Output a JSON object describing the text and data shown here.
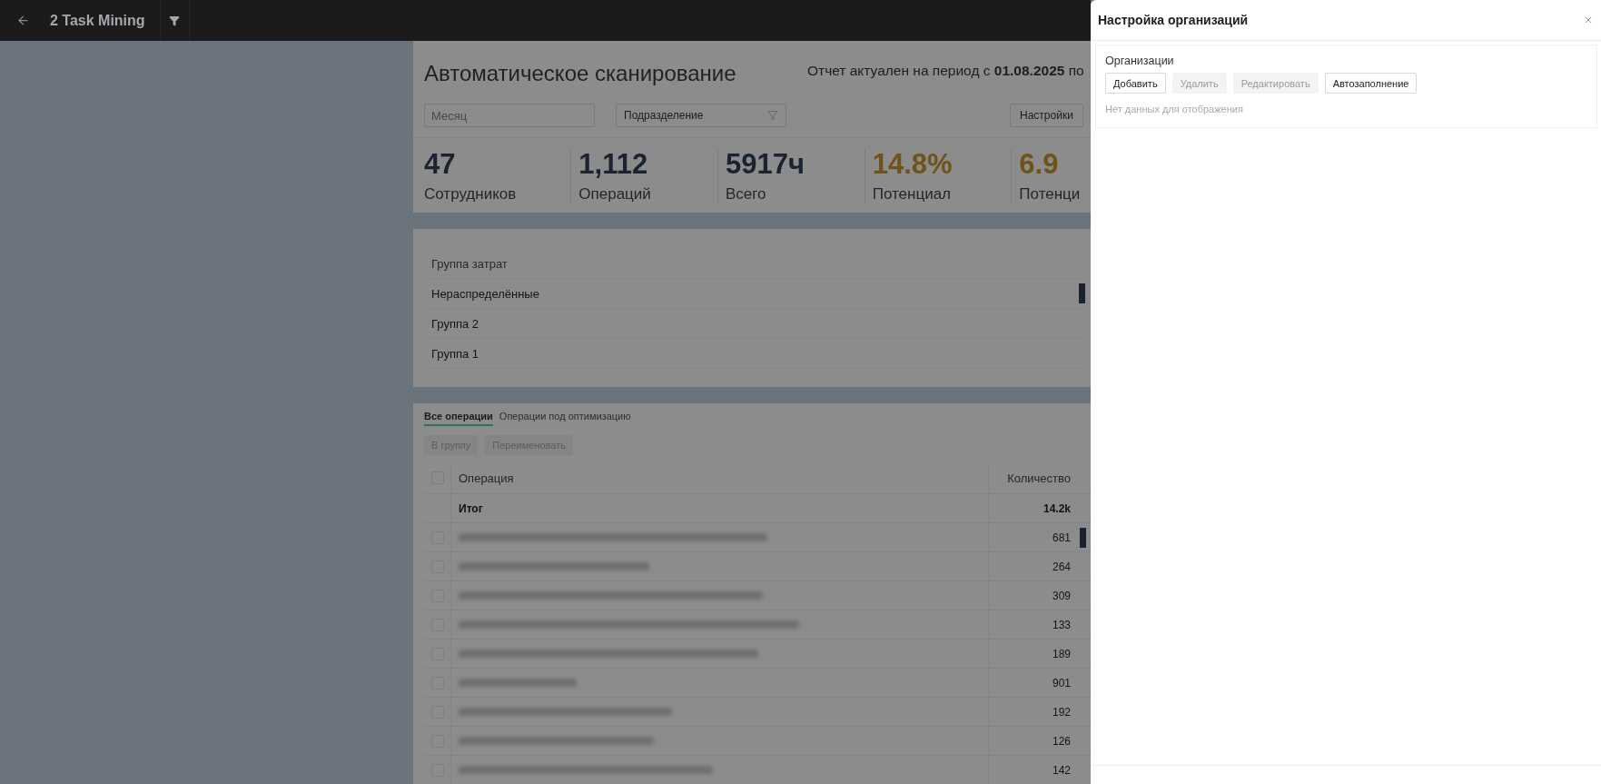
{
  "app_bar": {
    "title": "2 Task Mining"
  },
  "report": {
    "title": "Автоматическое сканирование",
    "period": "Отчет актуален на период с **01.08.2025** по"
  },
  "filters": {
    "month": {
      "placeholder": "Месяц"
    },
    "division": {
      "value": "Подразделение"
    },
    "settings_button": "Настройки"
  },
  "kpis": [
    {
      "value": "47",
      "label": "Сотрудников",
      "highlight": false
    },
    {
      "value": "1,112",
      "label": "Операций",
      "highlight": false
    },
    {
      "value": "5917ч",
      "label": "Всего",
      "highlight": false
    },
    {
      "value": "14.8%",
      "label": "Потенциал",
      "highlight": true
    },
    {
      "value": "6.9",
      "label": "Потенци",
      "highlight": true
    }
  ],
  "cost_groups": {
    "header": "Группа затрат",
    "rows": [
      {
        "name": "Нераспределённые",
        "bar": true
      },
      {
        "name": "Группа 2",
        "bar": false
      },
      {
        "name": "Группа 1",
        "bar": false
      }
    ]
  },
  "operations": {
    "tabs": [
      {
        "label": "Все операции",
        "selected": true
      },
      {
        "label": "Операции под оптимизацию",
        "selected": false
      }
    ],
    "buttons": [
      {
        "label": "В группу",
        "disabled": true
      },
      {
        "label": "Переименовать",
        "disabled": true
      }
    ],
    "columns": [
      "Операция",
      "Количество"
    ],
    "header_checked": false,
    "total": {
      "label": "Итог",
      "count": "14.2k"
    },
    "rows": [
      {
        "count": "681",
        "checked": false,
        "bar": true
      },
      {
        "count": "264",
        "checked": false,
        "bar": false
      },
      {
        "count": "309",
        "checked": false,
        "bar": false
      },
      {
        "count": "133",
        "checked": false,
        "bar": false
      },
      {
        "count": "189",
        "checked": false,
        "bar": false
      },
      {
        "count": "901",
        "checked": false,
        "bar": false
      },
      {
        "count": "192",
        "checked": false,
        "bar": false
      },
      {
        "count": "126",
        "checked": false,
        "bar": false
      },
      {
        "count": "142",
        "checked": false,
        "bar": false
      }
    ]
  },
  "drawer": {
    "title": "Настройка организаций",
    "section": "Организации",
    "buttons": [
      {
        "label": "Добавить",
        "disabled": false
      },
      {
        "label": "Удалить",
        "disabled": true
      },
      {
        "label": "Редактировать",
        "disabled": true
      },
      {
        "label": "Автозаполнение",
        "disabled": false
      }
    ],
    "empty_text": "Нет данных для отображения"
  }
}
